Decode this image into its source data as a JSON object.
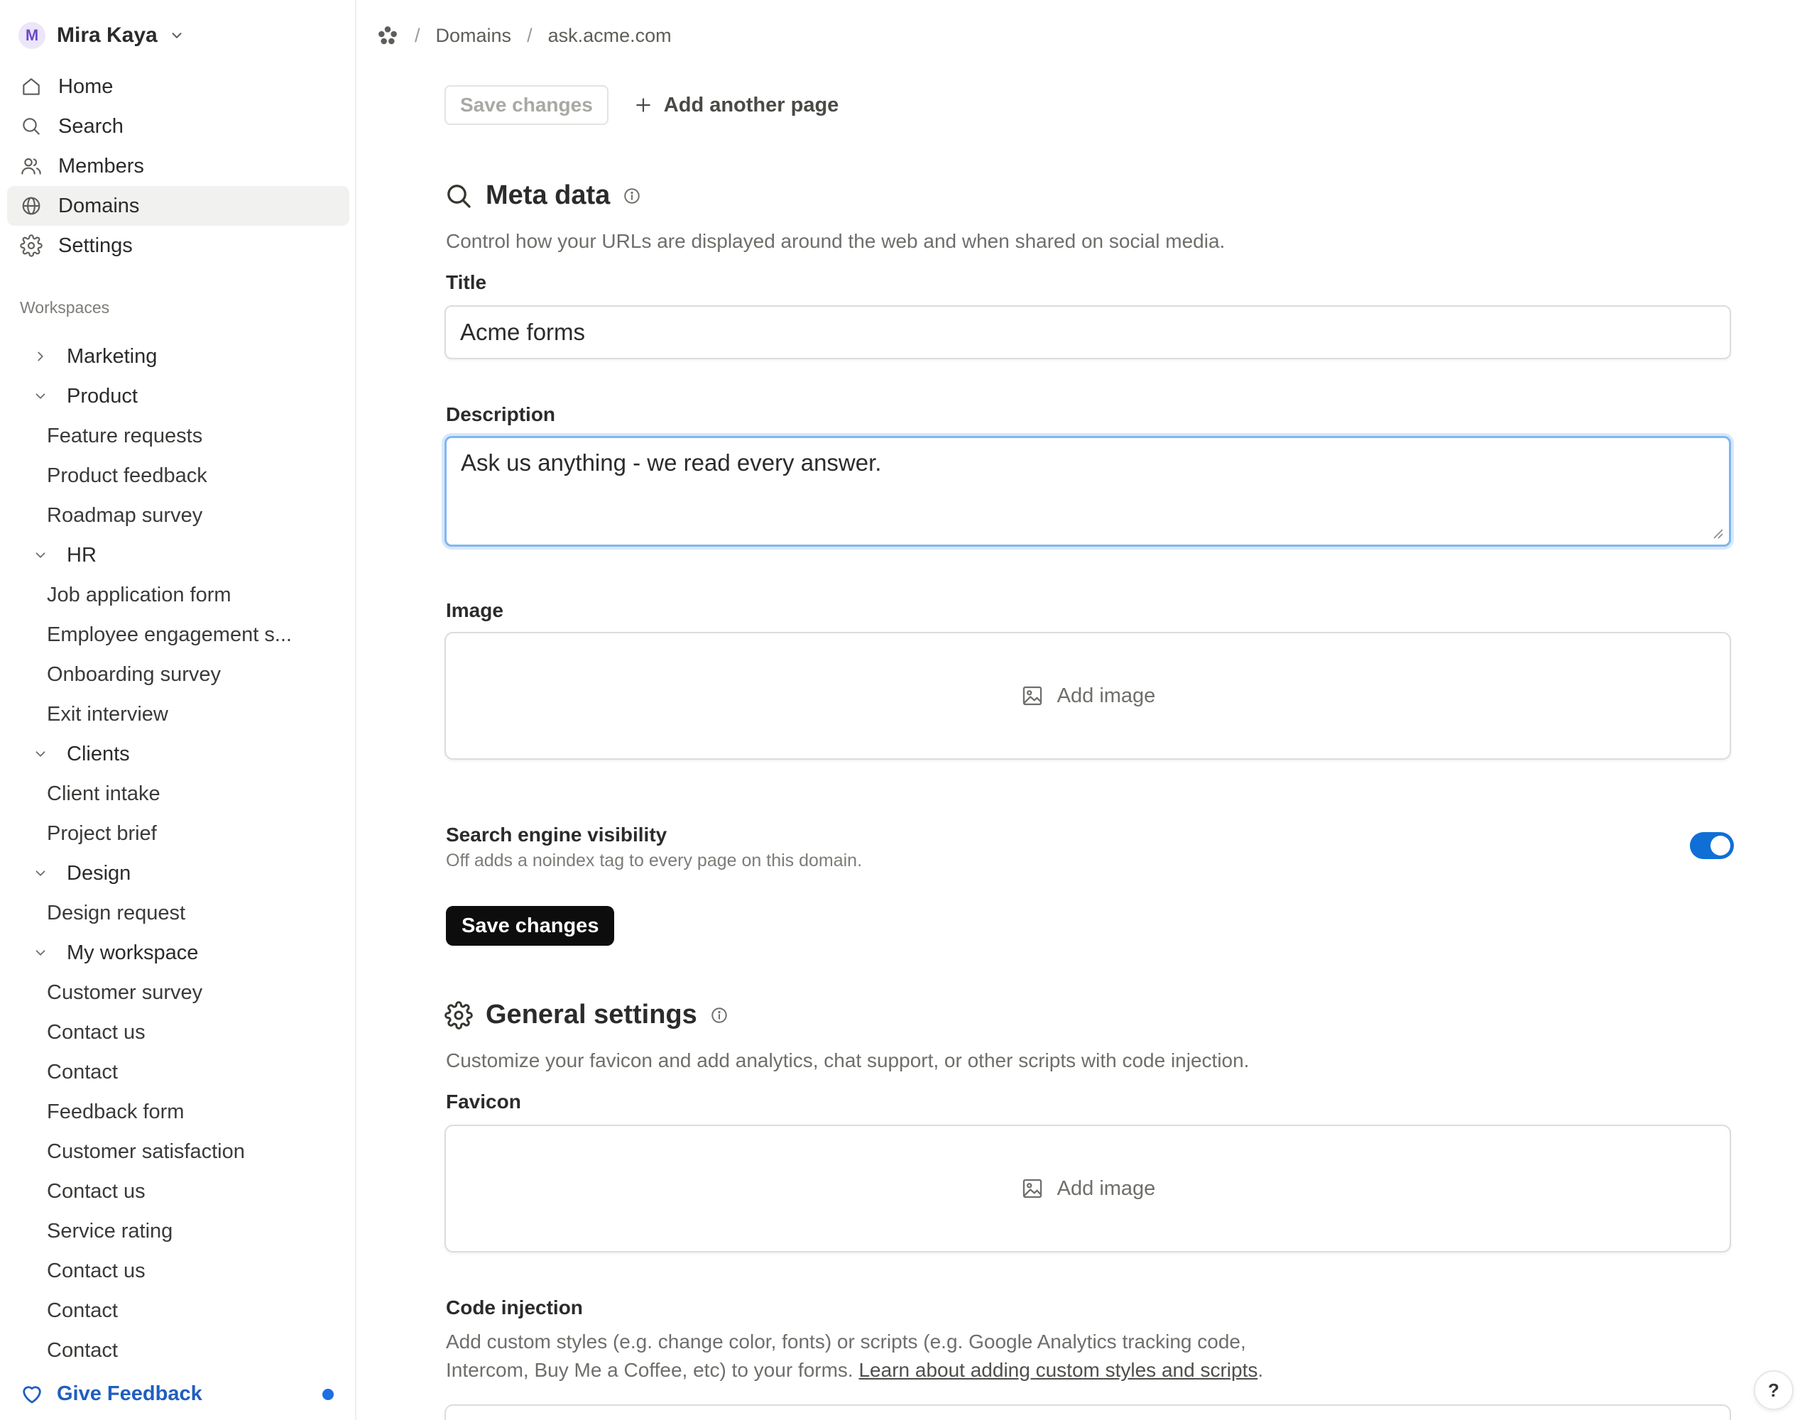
{
  "user": {
    "initial": "M",
    "name": "Mira Kaya"
  },
  "nav": {
    "items": [
      {
        "label": "Home",
        "icon": "home-icon"
      },
      {
        "label": "Search",
        "icon": "search-icon"
      },
      {
        "label": "Members",
        "icon": "users-icon"
      },
      {
        "label": "Domains",
        "icon": "globe-icon",
        "active": true
      },
      {
        "label": "Settings",
        "icon": "gear-icon"
      }
    ]
  },
  "workspaces": {
    "heading": "Workspaces",
    "groups": [
      {
        "name": "Marketing",
        "expanded": false,
        "pages": []
      },
      {
        "name": "Product",
        "expanded": true,
        "pages": [
          "Feature requests",
          "Product feedback",
          "Roadmap survey"
        ]
      },
      {
        "name": "HR",
        "expanded": true,
        "pages": [
          "Job application form",
          "Employee engagement s...",
          "Onboarding survey",
          "Exit interview"
        ]
      },
      {
        "name": "Clients",
        "expanded": true,
        "pages": [
          "Client intake",
          "Project brief"
        ]
      },
      {
        "name": "Design",
        "expanded": true,
        "pages": [
          "Design request"
        ]
      },
      {
        "name": "My workspace",
        "expanded": true,
        "pages": [
          "Customer survey",
          "Contact us",
          "Contact",
          "Feedback form",
          "Customer satisfaction",
          "Contact us",
          "Service rating",
          "Contact us",
          "Contact",
          "Contact"
        ]
      }
    ]
  },
  "feedback": {
    "label": "Give Feedback"
  },
  "breadcrumb": {
    "section": "Domains",
    "current": "ask.acme.com"
  },
  "toolbar": {
    "save_label": "Save changes",
    "add_page_label": "Add another page"
  },
  "meta": {
    "title": "Meta data",
    "description": "Control how your URLs are displayed around the web and when shared on social media.",
    "title_label": "Title",
    "title_value": "Acme forms",
    "description_label": "Description",
    "description_value": "Ask us anything - we read every answer.",
    "image_label": "Image",
    "add_image_label": "Add image",
    "visibility_title": "Search engine visibility",
    "visibility_sub": "Off adds a noindex tag to every page on this domain.",
    "visibility_on": true,
    "save_label": "Save changes"
  },
  "general": {
    "title": "General settings",
    "description": "Customize your favicon and add analytics, chat support, or other scripts with code injection.",
    "favicon_label": "Favicon",
    "add_image_label": "Add image",
    "code_label": "Code injection",
    "code_desc": "Add custom styles (e.g. change color, fonts) or scripts (e.g. Google Analytics tracking code, Intercom, Buy Me a Coffee, etc) to your forms.",
    "code_link": "Learn about adding custom styles and scripts",
    "code_period": "."
  },
  "help": {
    "label": "?"
  },
  "colors": {
    "accent": "#0f6fd6",
    "feedback": "#1f5fbf",
    "focus_ring": "#7fb6ef",
    "primary_button": "#0d0d0d"
  }
}
